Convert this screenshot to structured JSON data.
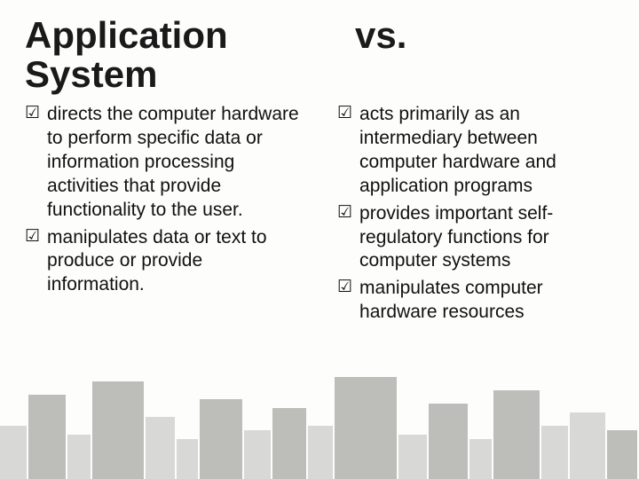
{
  "left": {
    "title_line1": "Application",
    "title_line2": "System",
    "bullets": [
      "directs the computer hardware to perform specific data or information processing activities that provide functionality to the user.",
      "manipulates data or text to produce or provide information."
    ]
  },
  "right": {
    "title": "vs.",
    "bullets": [
      "acts primarily as an intermediary between computer hardware and application programs",
      "provides important self-regulatory functions for computer systems",
      "manipulates computer hardware resources"
    ]
  },
  "bullet_glyph": "☑"
}
